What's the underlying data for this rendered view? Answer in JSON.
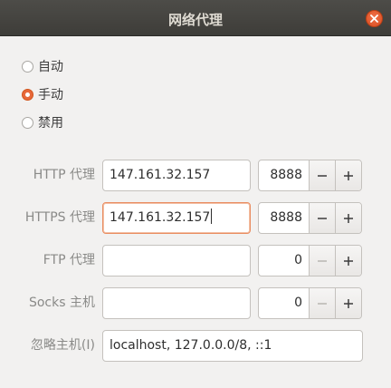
{
  "window": {
    "title": "网络代理"
  },
  "mode": {
    "options": [
      {
        "label": "自动",
        "checked": false
      },
      {
        "label": "手动",
        "checked": true
      },
      {
        "label": "禁用",
        "checked": false
      }
    ]
  },
  "proxies": [
    {
      "label": "HTTP 代理",
      "host": "147.161.32.157",
      "port": "8888",
      "focused": false,
      "minus_enabled": true
    },
    {
      "label": "HTTPS 代理",
      "host": "147.161.32.157",
      "port": "8888",
      "focused": true,
      "minus_enabled": true
    },
    {
      "label": "FTP 代理",
      "host": "",
      "port": "0",
      "focused": false,
      "minus_enabled": false
    },
    {
      "label": "Socks 主机",
      "host": "",
      "port": "0",
      "focused": false,
      "minus_enabled": false
    }
  ],
  "ignore_hosts": {
    "label": "忽略主机(I)",
    "value": "localhost, 127.0.0.0/8, ::1"
  },
  "colors": {
    "titlebar": "#3e3d39",
    "accent": "#e7683a",
    "background": "#f2f1f0"
  }
}
